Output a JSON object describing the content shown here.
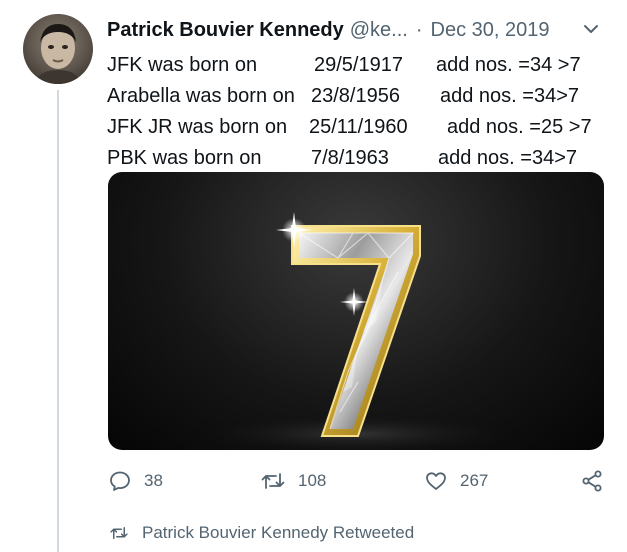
{
  "tweet": {
    "author_name": "Patrick Bouvier Kennedy",
    "handle": "@ke...",
    "separator": "·",
    "date": "Dec 30, 2019",
    "lines": [
      {
        "label": "JFK was born on",
        "date": "29/5/1917",
        "sum": "add nos. =34 >7"
      },
      {
        "label": "Arabella was born on",
        "date": "23/8/1956",
        "sum": "add nos. =34>7"
      },
      {
        "label": "JFK JR was born on",
        "date": "25/11/1960",
        "sum": "add nos. =25 >7"
      },
      {
        "label": "PBK was born on",
        "date": "7/8/1963",
        "sum": "add nos. =34>7"
      }
    ],
    "media_description_icon": "diamond-number-seven-image"
  },
  "actions": {
    "reply_count": "38",
    "retweet_count": "108",
    "like_count": "267"
  },
  "icons": {
    "reply": "speech-bubble-icon",
    "retweet": "retweet-arrows-icon",
    "like": "heart-icon",
    "share": "share-nodes-icon",
    "more": "chevron-down-icon"
  },
  "retweet_notice": "Patrick Bouvier Kennedy Retweeted",
  "colors": {
    "text": "#0f1419",
    "secondary": "#536471",
    "gold": "#d9b23a"
  }
}
